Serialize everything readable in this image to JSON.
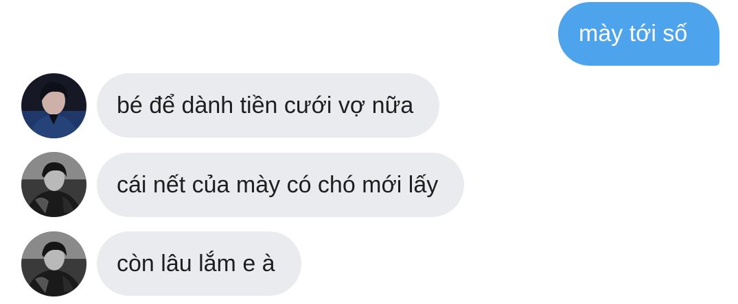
{
  "messages": [
    {
      "direction": "outgoing",
      "text": "mày tới số"
    },
    {
      "direction": "incoming",
      "avatar": "avatar-1",
      "text": "bé để dành tiền cưới vợ nữa"
    },
    {
      "direction": "incoming",
      "avatar": "avatar-2",
      "text": "cái nết của mày có chó mới lấy"
    },
    {
      "direction": "incoming",
      "avatar": "avatar-2",
      "text": "còn lâu lắm e à"
    }
  ],
  "colors": {
    "outgoing_bubble": "#4da3ec",
    "incoming_bubble": "#e9ebef",
    "incoming_text": "#1e1e1e",
    "outgoing_text": "#ffffff"
  }
}
